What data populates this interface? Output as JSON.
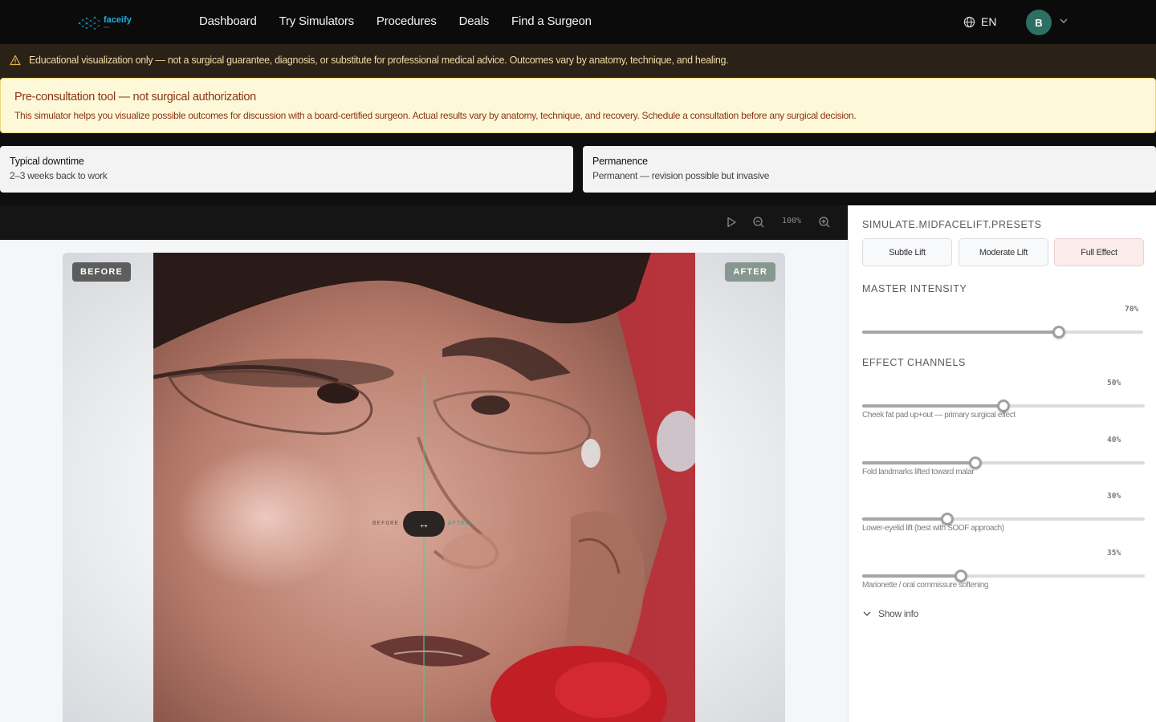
{
  "brand": {
    "name": "faceify",
    "sub": "labs"
  },
  "nav": {
    "links": [
      "Dashboard",
      "Try Simulators",
      "Procedures",
      "Deals",
      "Find a Surgeon"
    ],
    "language": "EN",
    "avatar_initial": "B"
  },
  "disclaimer": {
    "text": "Educational visualization only — not a surgical guarantee, diagnosis, or substitute for professional medical advice. Outcomes vary by anatomy, technique, and healing."
  },
  "preconsult": {
    "title": "Pre-consultation tool — not surgical authorization",
    "body": "This simulator helps you visualize possible outcomes for discussion with a board-certified surgeon. Actual results vary by anatomy, technique, and recovery. Schedule a consultation before any surgical decision."
  },
  "cards": [
    {
      "title": "Typical downtime",
      "value": "2–3 weeks back to work"
    },
    {
      "title": "Permanence",
      "value": "Permanent — revision possible but invasive"
    }
  ],
  "viewer": {
    "zoom": "100%",
    "before_tag": "BEFORE",
    "after_tag": "AFTER",
    "divider_before": "BEFORE",
    "divider_after": "AFTER",
    "handle_glyph": "↔"
  },
  "panel": {
    "presets_heading": "SIMULATE.MIDFACELIFT.PRESETS",
    "presets": [
      "Subtle Lift",
      "Moderate Lift",
      "Full Effect"
    ],
    "active_preset": "Full Effect",
    "master_heading": "MASTER INTENSITY",
    "master": {
      "label": "70%",
      "value": 0.7
    },
    "channels_heading": "EFFECT CHANNELS",
    "channels": [
      {
        "pct": "50%",
        "value": 0.5,
        "label": "Cheek fat pad up+out — primary surgical effect"
      },
      {
        "pct": "40%",
        "value": 0.4,
        "label": "Fold landmarks lifted toward malar"
      },
      {
        "pct": "30%",
        "value": 0.3,
        "label": "Lower-eyelid lift (best with SOOF approach)"
      },
      {
        "pct": "35%",
        "value": 0.35,
        "label": "Marionette / oral commissure softening"
      }
    ],
    "show_info": "Show info"
  },
  "icons": {
    "disclaimer": "warning-triangle-icon",
    "language": "globe-icon",
    "avatar_menu": "chevron-down-icon",
    "play": "play-icon",
    "zoom_out": "zoom-out-icon",
    "zoom_in": "zoom-in-icon",
    "show_info": "chevron-down-icon"
  },
  "colors": {
    "accent": "#2aa8d6",
    "avatar": "#2f6f63",
    "warning_text": "#8a3515",
    "banner_bg": "#fdf8d8",
    "active_preset_bg": "#fcecec"
  }
}
